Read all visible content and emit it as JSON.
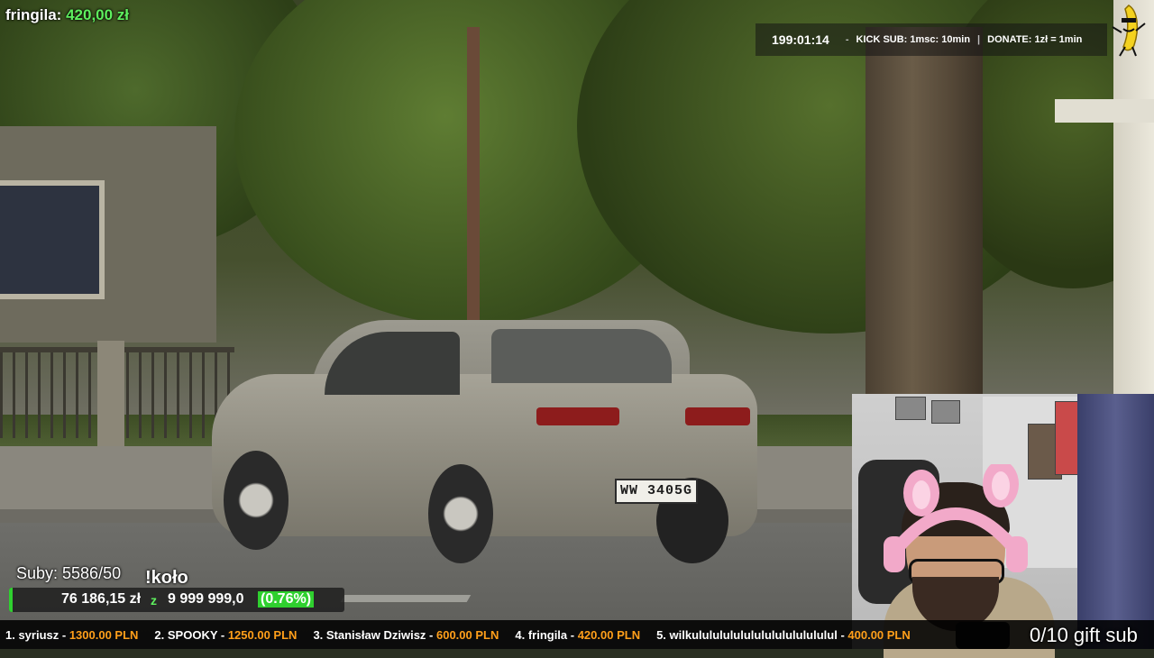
{
  "top_donation": {
    "name": "fringila:",
    "amount": "420,00 zł"
  },
  "info_bar": {
    "timer": "199:01:14",
    "dash": "-",
    "kick_sub": "KICK SUB: 1msc: 10min",
    "separator": "|",
    "donate": "DONATE: 1zł = 1min"
  },
  "subs": {
    "label": "Suby: 5586/50"
  },
  "wheel_command": "!koło",
  "donation_goal": {
    "current": "76 186,15 zł",
    "currency_fragment": "z",
    "target": "9 999 999,0",
    "percent_text": "(0.76%)",
    "percent_value": 0.76
  },
  "leaderboard": [
    {
      "rank_name": "1. syriusz - ",
      "amount": "1300.00 PLN"
    },
    {
      "rank_name": "2. SPOOKY - ",
      "amount": "1250.00 PLN"
    },
    {
      "rank_name": "3. Stanisław Dziwisz - ",
      "amount": "600.00 PLN"
    },
    {
      "rank_name": "4. fringila - ",
      "amount": "420.00 PLN"
    },
    {
      "rank_name": "5. wilkulululululululululululululul - ",
      "amount": "400.00 PLN"
    }
  ],
  "gift_sub": "0/10 gift sub",
  "license_plate": "WW 3405G",
  "colors": {
    "green_accent": "#5ef05e",
    "goal_fill": "#2fd02f",
    "ticker_amount": "#ff9f1a",
    "ticker_bg": "#000000"
  },
  "icons": {
    "mascot": "banana-mascot-icon"
  }
}
